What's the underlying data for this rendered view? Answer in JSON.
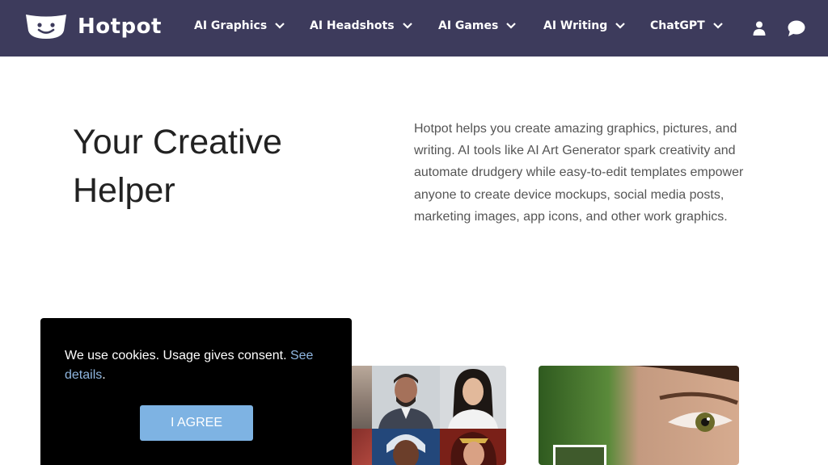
{
  "brand": {
    "name": "Hotpot"
  },
  "nav": {
    "items": [
      {
        "label": "AI Graphics"
      },
      {
        "label": "AI Headshots"
      },
      {
        "label": "AI Games"
      },
      {
        "label": "AI Writing"
      },
      {
        "label": "ChatGPT"
      }
    ],
    "icons": [
      "user-icon",
      "chat-icon"
    ]
  },
  "hero": {
    "title": "Your Creative Helper",
    "description": "Hotpot helps you create amazing graphics, pictures, and writing. AI tools like AI Art Generator spark creativity and automate drudgery while easy-to-edit templates empower anyone to create device mockups, social media posts, marketing images, app icons, and other work graphics."
  },
  "cookie": {
    "text": "We use cookies. Usage gives consent. ",
    "link": "See details",
    "suffix": ".",
    "button": "I AGREE"
  },
  "colors": {
    "navbar": "#3d3b5c",
    "cookie_bg": "#000000",
    "link": "#8fb6e0",
    "button": "#7eb3e3"
  }
}
